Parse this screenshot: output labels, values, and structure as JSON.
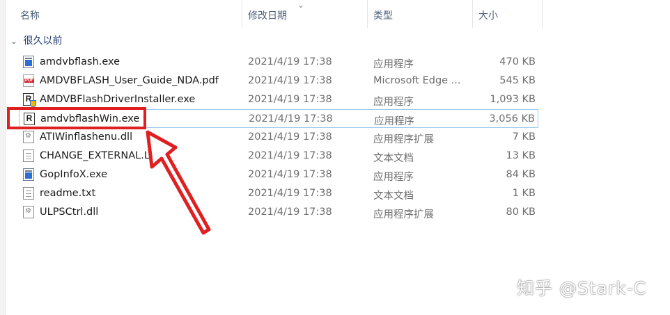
{
  "columns": {
    "name": "名称",
    "date": "修改日期",
    "type": "类型",
    "size": "大小"
  },
  "group_label": "很久以前",
  "files": [
    {
      "name": "amdvbflash.exe",
      "date": "2021/4/19 17:38",
      "type": "应用程序",
      "size": "470 KB",
      "icon": "exe-icon"
    },
    {
      "name": "AMDVBFLASH_User_Guide_NDA.pdf",
      "date": "2021/4/19 17:38",
      "type": "Microsoft Edge ...",
      "size": "545 KB",
      "icon": "pdf-icon"
    },
    {
      "name": "AMDVBFlashDriverInstaller.exe",
      "date": "2021/4/19 17:38",
      "type": "应用程序",
      "size": "1,093 KB",
      "icon": "r-shield-icon"
    },
    {
      "name": "amdvbflashWin.exe",
      "date": "2021/4/19 17:38",
      "type": "应用程序",
      "size": "3,056 KB",
      "icon": "r-icon"
    },
    {
      "name": "ATIWinflashenu.dll",
      "date": "2021/4/19 17:38",
      "type": "应用程序扩展",
      "size": "7 KB",
      "icon": "dll-icon"
    },
    {
      "name": "CHANGE_EXTERNAL.LOG",
      "date": "2021/4/19 17:38",
      "type": "文本文档",
      "size": "13 KB",
      "icon": "text-icon"
    },
    {
      "name": "GopInfoX.exe",
      "date": "2021/4/19 17:38",
      "type": "应用程序",
      "size": "84 KB",
      "icon": "exe-icon"
    },
    {
      "name": "readme.txt",
      "date": "2021/4/19 17:38",
      "type": "文本文档",
      "size": "1 KB",
      "icon": "text-icon"
    },
    {
      "name": "ULPSCtrl.dll",
      "date": "2021/4/19 17:38",
      "type": "应用程序扩展",
      "size": "80 KB",
      "icon": "dll-icon"
    }
  ],
  "annotation": {
    "color": "#e02020"
  },
  "watermark": "知乎 @Stark-C"
}
